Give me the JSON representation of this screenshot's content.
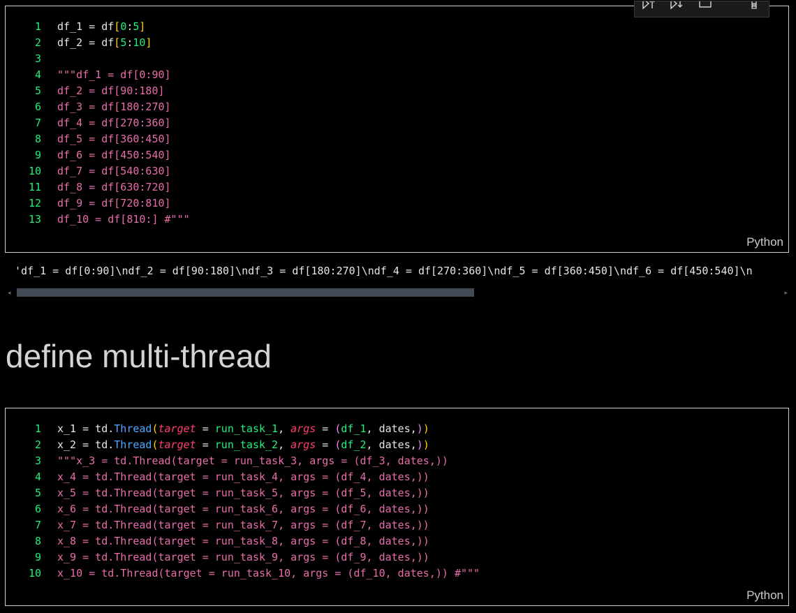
{
  "cell1": {
    "language": "Python",
    "lines": [
      {
        "num": "1",
        "tokens": [
          {
            "t": "df_1 = df",
            "c": "plain"
          },
          {
            "t": "[",
            "c": "par"
          },
          {
            "t": "0",
            "c": "grn"
          },
          {
            "t": ":",
            "c": "plain"
          },
          {
            "t": "5",
            "c": "grn"
          },
          {
            "t": "]",
            "c": "par"
          }
        ]
      },
      {
        "num": "2",
        "tokens": [
          {
            "t": "df_2 = df",
            "c": "plain"
          },
          {
            "t": "[",
            "c": "par"
          },
          {
            "t": "5",
            "c": "grn"
          },
          {
            "t": ":",
            "c": "plain"
          },
          {
            "t": "10",
            "c": "grn"
          },
          {
            "t": "]",
            "c": "par"
          }
        ]
      },
      {
        "num": "3",
        "tokens": []
      },
      {
        "num": "4",
        "tokens": [
          {
            "t": "\"\"\"df_1 = df[0:90]",
            "c": "str"
          }
        ]
      },
      {
        "num": "5",
        "tokens": [
          {
            "t": "df_2 = df[90:180]",
            "c": "str"
          }
        ]
      },
      {
        "num": "6",
        "tokens": [
          {
            "t": "df_3 = df[180:270]",
            "c": "str"
          }
        ]
      },
      {
        "num": "7",
        "tokens": [
          {
            "t": "df_4 = df[270:360]",
            "c": "str"
          }
        ]
      },
      {
        "num": "8",
        "tokens": [
          {
            "t": "df_5 = df[360:450]",
            "c": "str"
          }
        ]
      },
      {
        "num": "9",
        "tokens": [
          {
            "t": "df_6 = df[450:540]",
            "c": "str"
          }
        ]
      },
      {
        "num": "10",
        "tokens": [
          {
            "t": "df_7 = df[540:630]",
            "c": "str"
          }
        ]
      },
      {
        "num": "11",
        "tokens": [
          {
            "t": "df_8 = df[630:720]",
            "c": "str"
          }
        ]
      },
      {
        "num": "12",
        "tokens": [
          {
            "t": "df_9 = df[720:810]",
            "c": "str"
          }
        ]
      },
      {
        "num": "13",
        "tokens": [
          {
            "t": "df_10 = df[810:] #\"\"\"",
            "c": "str"
          }
        ]
      }
    ]
  },
  "output": {
    "text": "'df_1 = df[0:90]\\ndf_2 = df[90:180]\\ndf_3 = df[180:270]\\ndf_4 = df[270:360]\\ndf_5 = df[360:450]\\ndf_6 = df[450:540]\\n"
  },
  "heading": {
    "text": "define multi-thread"
  },
  "cell2": {
    "language": "Python",
    "lines": [
      {
        "num": "1",
        "tokens": [
          {
            "t": "x_1 = td.",
            "c": "plain"
          },
          {
            "t": "Thread",
            "c": "fn"
          },
          {
            "t": "(",
            "c": "par"
          },
          {
            "t": "target",
            "c": "arg"
          },
          {
            "t": " = ",
            "c": "plain"
          },
          {
            "t": "run_task_1",
            "c": "grn"
          },
          {
            "t": ", ",
            "c": "plain"
          },
          {
            "t": "args",
            "c": "arg"
          },
          {
            "t": " = ",
            "c": "plain"
          },
          {
            "t": "(",
            "c": "vio"
          },
          {
            "t": "df_1",
            "c": "grn"
          },
          {
            "t": ", dates,",
            "c": "plain"
          },
          {
            "t": ")",
            "c": "vio"
          },
          {
            "t": ")",
            "c": "par"
          }
        ]
      },
      {
        "num": "2",
        "tokens": [
          {
            "t": "x_2 = td.",
            "c": "plain"
          },
          {
            "t": "Thread",
            "c": "fn"
          },
          {
            "t": "(",
            "c": "par"
          },
          {
            "t": "target",
            "c": "arg"
          },
          {
            "t": " = ",
            "c": "plain"
          },
          {
            "t": "run_task_2",
            "c": "grn"
          },
          {
            "t": ", ",
            "c": "plain"
          },
          {
            "t": "args",
            "c": "arg"
          },
          {
            "t": " = ",
            "c": "plain"
          },
          {
            "t": "(",
            "c": "vio"
          },
          {
            "t": "df_2",
            "c": "grn"
          },
          {
            "t": ", dates,",
            "c": "plain"
          },
          {
            "t": ")",
            "c": "vio"
          },
          {
            "t": ")",
            "c": "par"
          }
        ]
      },
      {
        "num": "3",
        "tokens": [
          {
            "t": "\"\"\"x_3 = td.Thread(target = run_task_3, args = (df_3, dates,))",
            "c": "str"
          }
        ]
      },
      {
        "num": "4",
        "tokens": [
          {
            "t": "x_4 = td.Thread(target = run_task_4, args = (df_4, dates,))",
            "c": "str"
          }
        ]
      },
      {
        "num": "5",
        "tokens": [
          {
            "t": "x_5 = td.Thread(target = run_task_5, args = (df_5, dates,))",
            "c": "str"
          }
        ]
      },
      {
        "num": "6",
        "tokens": [
          {
            "t": "x_6 = td.Thread(target = run_task_6, args = (df_6, dates,))",
            "c": "str"
          }
        ]
      },
      {
        "num": "7",
        "tokens": [
          {
            "t": "x_7 = td.Thread(target = run_task_7, args = (df_7, dates,))",
            "c": "str"
          }
        ]
      },
      {
        "num": "8",
        "tokens": [
          {
            "t": "x_8 = td.Thread(target = run_task_8, args = (df_8, dates,))",
            "c": "str"
          }
        ]
      },
      {
        "num": "9",
        "tokens": [
          {
            "t": "x_9 = td.Thread(target = run_task_9, args = (df_9, dates,))",
            "c": "str"
          }
        ]
      },
      {
        "num": "10",
        "tokens": [
          {
            "t": "x_10 = td.Thread(target = run_task_10, args = (df_10, dates,)) #\"\"\"",
            "c": "str"
          }
        ]
      }
    ]
  },
  "toolbar": {
    "icons": [
      "run-above-icon",
      "run-below-icon",
      "split-cell-icon",
      "delete-icon"
    ]
  }
}
